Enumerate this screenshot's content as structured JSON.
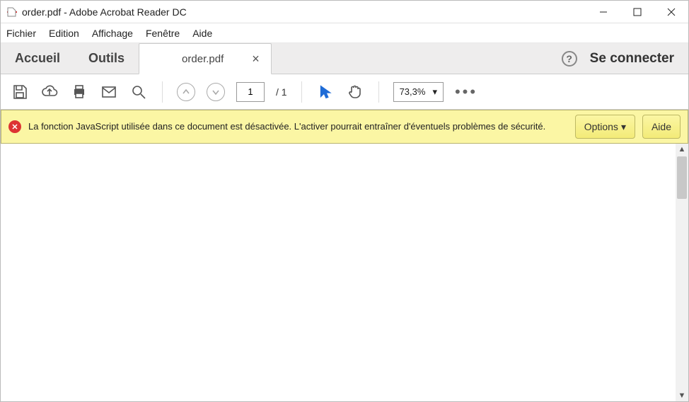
{
  "titlebar": {
    "text": "order.pdf - Adobe Acrobat Reader DC"
  },
  "menubar": {
    "items": [
      "Fichier",
      "Edition",
      "Affichage",
      "Fenêtre",
      "Aide"
    ]
  },
  "tabs": {
    "home": "Accueil",
    "tools": "Outils",
    "file": "order.pdf",
    "signin": "Se connecter"
  },
  "toolbar": {
    "page_current": "1",
    "page_total": "/ 1",
    "zoom": "73,3%"
  },
  "warning": {
    "text": "La fonction JavaScript utilisée dans ce document est désactivée. L'activer pourrait entraîner d'éventuels problèmes de sécurité.",
    "options": "Options",
    "help": "Aide"
  }
}
